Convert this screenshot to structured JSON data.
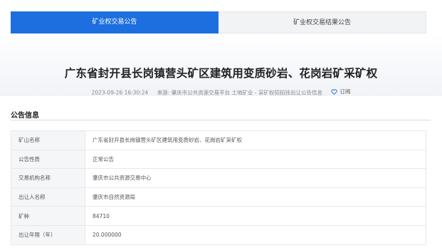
{
  "tabs": [
    {
      "label": "矿业权交易公告",
      "active": true
    },
    {
      "label": "矿业权交易结果公告",
      "active": false
    }
  ],
  "notice": {
    "title": "广东省封开县长岗镇营头矿区建筑用变质砂岩、花岗岩矿采矿权",
    "datetime": "2023-09-26 16:30:24",
    "source_label": "来源:",
    "source": "肇庆市公共资源交易平台 土地矿业 - 采矿权招拍挂出让公告信息",
    "subscribe_label": "订阅"
  },
  "section": {
    "title": "公告信息"
  },
  "info_rows": [
    {
      "key": "矿山名称",
      "value": "广东省封开县长岗镇营头矿区建筑用变质砂岩、花岗岩矿采矿权"
    },
    {
      "key": "公告性质",
      "value": "正常公告"
    },
    {
      "key": "交易机构名称",
      "value": "肇庆市公共资源交易中心"
    },
    {
      "key": "出让人名称",
      "value": "肇庆市自然资源局"
    },
    {
      "key": "矿种",
      "value": "84710"
    },
    {
      "key": "出让年限（年）",
      "value": "20.000000"
    }
  ],
  "colors": {
    "accent": "#1d6fe0",
    "tab_inactive_bg": "#f2f3f5",
    "table_key_bg": "#f5f6f8"
  },
  "icons": {
    "subscribe": "heart-outline-icon"
  }
}
